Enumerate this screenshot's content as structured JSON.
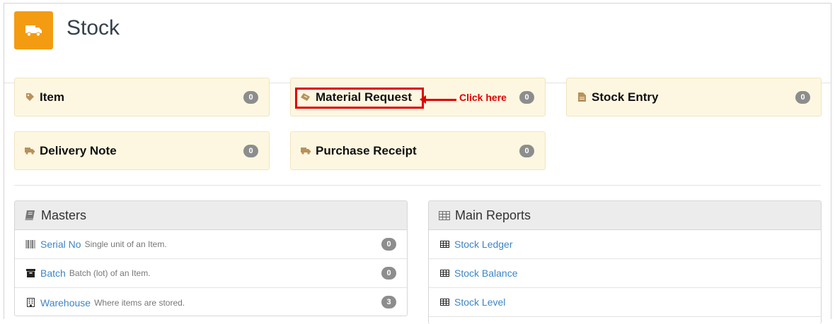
{
  "header": {
    "title": "Stock",
    "icon": "truck-icon",
    "icon_bg": "#f39c12"
  },
  "cards": [
    {
      "label": "Item",
      "icon": "tag-icon",
      "count": "0"
    },
    {
      "label": "Material Request",
      "icon": "ticket-icon",
      "count": "0"
    },
    {
      "label": "Stock Entry",
      "icon": "file-icon",
      "count": "0"
    },
    {
      "label": "Delivery Note",
      "icon": "truck-icon",
      "count": "0"
    },
    {
      "label": "Purchase Receipt",
      "icon": "truck-icon",
      "count": "0"
    }
  ],
  "annotation": {
    "text": "Click here",
    "color": "#e00000"
  },
  "masters": {
    "title": "Masters",
    "items": [
      {
        "label": "Serial No",
        "desc": "Single unit of an Item.",
        "icon": "barcode-icon",
        "count": "0"
      },
      {
        "label": "Batch",
        "desc": "Batch (lot) of an Item.",
        "icon": "archive-icon",
        "count": "0"
      },
      {
        "label": "Warehouse",
        "desc": "Where items are stored.",
        "icon": "building-icon",
        "count": "3"
      }
    ]
  },
  "reports": {
    "title": "Main Reports",
    "items": [
      {
        "label": "Stock Ledger",
        "icon": "table-icon"
      },
      {
        "label": "Stock Balance",
        "icon": "table-icon"
      },
      {
        "label": "Stock Level",
        "icon": "table-icon"
      }
    ]
  },
  "colors": {
    "card_bg": "#fdf7e1",
    "link": "#3d85c6",
    "badge": "#8d8d8d",
    "accent": "#f39c12"
  }
}
